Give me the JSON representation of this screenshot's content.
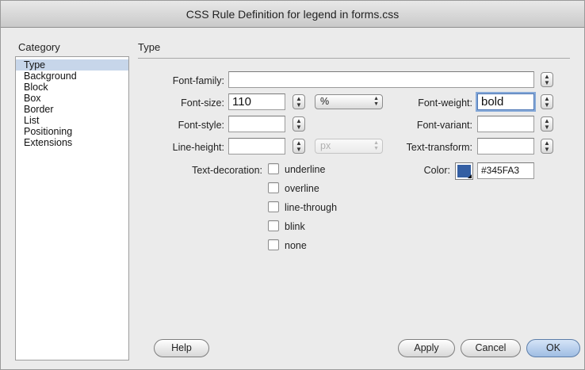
{
  "window": {
    "title": "CSS Rule Definition for legend in forms.css"
  },
  "category": {
    "title": "Category",
    "items": [
      "Type",
      "Background",
      "Block",
      "Box",
      "Border",
      "List",
      "Positioning",
      "Extensions"
    ],
    "selected": "Type"
  },
  "section": {
    "title": "Type"
  },
  "fields": {
    "font_family": {
      "label": "Font-family:",
      "value": ""
    },
    "font_size": {
      "label": "Font-size:",
      "value": "110",
      "unit": "%"
    },
    "font_weight": {
      "label": "Font-weight:",
      "value": "bold"
    },
    "font_style": {
      "label": "Font-style:",
      "value": ""
    },
    "font_variant": {
      "label": "Font-variant:",
      "value": ""
    },
    "line_height": {
      "label": "Line-height:",
      "value": "",
      "unit": "px"
    },
    "text_transform": {
      "label": "Text-transform:",
      "value": ""
    },
    "color": {
      "label": "Color:",
      "value": "#345FA3",
      "swatch": "#345FA3"
    }
  },
  "text_decoration": {
    "label": "Text-decoration:",
    "options": [
      "underline",
      "overline",
      "line-through",
      "blink",
      "none"
    ]
  },
  "buttons": {
    "help": "Help",
    "apply": "Apply",
    "cancel": "Cancel",
    "ok": "OK"
  }
}
